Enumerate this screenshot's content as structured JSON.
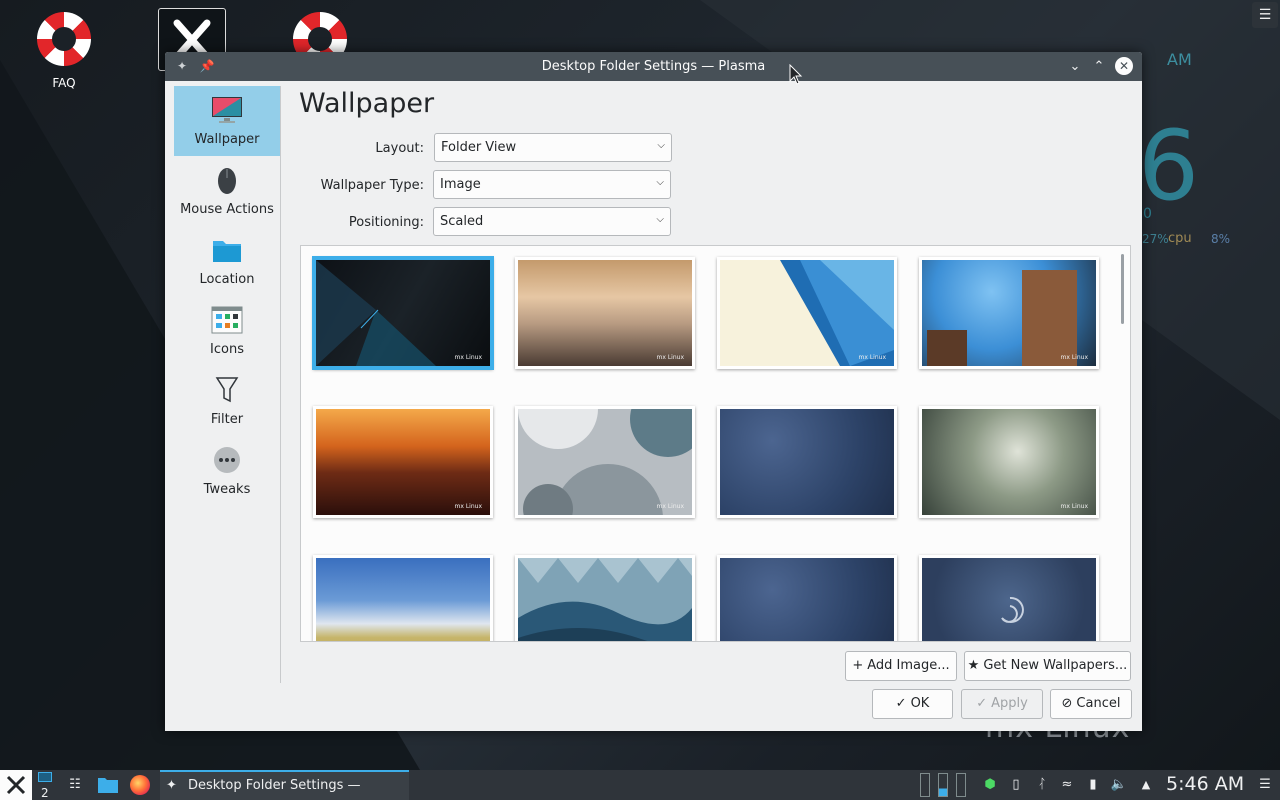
{
  "desktop": {
    "icons": [
      {
        "label": "FAQ"
      }
    ],
    "widget": {
      "ampm": "AM",
      "big_digit": "6",
      "small_zero": "0",
      "cpu_left": "27%",
      "cpu_label": "cpu",
      "cpu_right": "8%"
    },
    "brand": "mx Linux"
  },
  "window": {
    "title": "Desktop Folder Settings — Plasma",
    "sidebar": [
      {
        "label": "Wallpaper",
        "icon": "monitor-icon",
        "active": true
      },
      {
        "label": "Mouse Actions",
        "icon": "mouse-icon"
      },
      {
        "label": "Location",
        "icon": "folder-icon"
      },
      {
        "label": "Icons",
        "icon": "icons-grid-icon"
      },
      {
        "label": "Filter",
        "icon": "funnel-icon"
      },
      {
        "label": "Tweaks",
        "icon": "more-dots-icon"
      }
    ],
    "page_title": "Wallpaper",
    "form": {
      "layout_label": "Layout:",
      "layout_value": "Folder View",
      "type_label": "Wallpaper Type:",
      "type_value": "Image",
      "positioning_label": "Positioning:",
      "positioning_value": "Scaled"
    },
    "wallpaper_watermark": "mx Linux",
    "buttons": {
      "add_image": "Add Image...",
      "get_new": "Get New Wallpapers...",
      "ok": "OK",
      "apply": "Apply",
      "cancel": "Cancel"
    }
  },
  "taskbar": {
    "desktop_number": "2",
    "task_title": "Desktop Folder Settings — Plasma",
    "clock": "5:46 AM"
  },
  "colors": {
    "accent": "#3daee9",
    "selection": "#93cee9",
    "titlebar": "#475057",
    "window_bg": "#eff0f1"
  }
}
